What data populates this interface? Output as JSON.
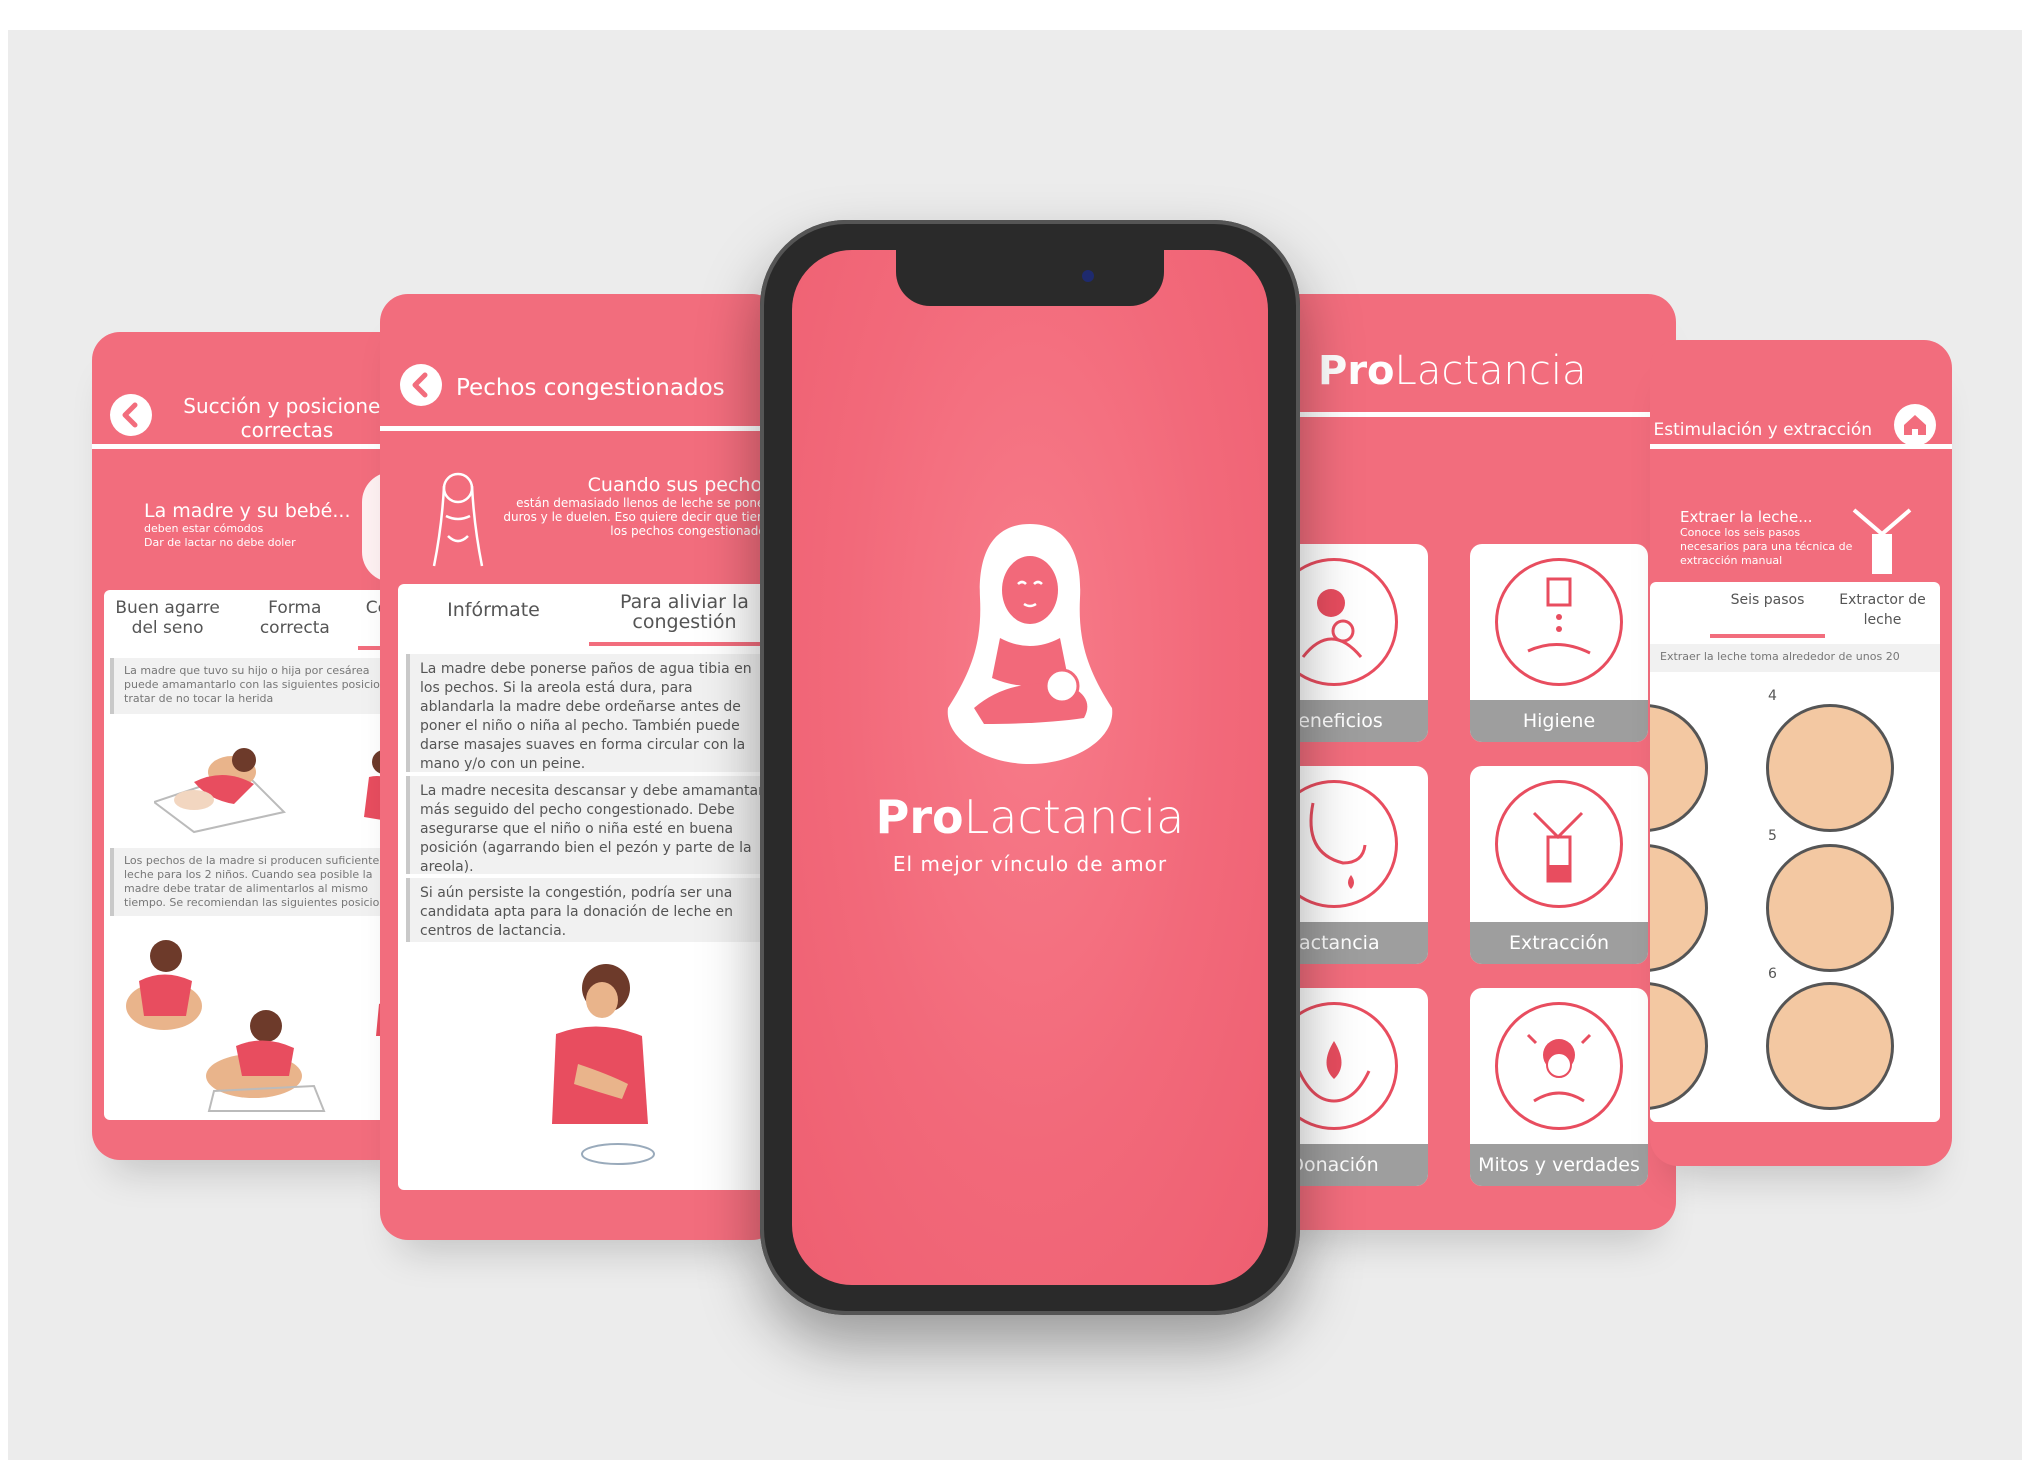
{
  "screens": {
    "succion": {
      "title_line1": "Succión y posiciones",
      "title_line2": "correctas",
      "banner_title": "La madre y su bebé...",
      "banner_sub1": "deben estar cómodos",
      "banner_sub2": "Dar de lactar no debe doler",
      "tabs": [
        "Buen agarre del seno",
        "Forma correcta",
        "Ce do"
      ],
      "text1": "La madre que tuvo su hijo o hija por cesárea puede amamantarlo con las siguientes posiciones tratar de no tocar la herida",
      "text2": "Los pechos de la madre si producen suficiente leche para los 2 niños. Cuando sea posible la madre debe tratar de alimentarlos al mismo tiempo. Se recomiendan las siguientes posiciones"
    },
    "pechos": {
      "title": "Pechos congestionados",
      "banner_title": "Cuando sus pechos",
      "banner_text": "están demasiado llenos de leche se ponen duros y le duelen. Eso quiere decir que tiene los pechos congestionados",
      "tabs": [
        "Infórmate",
        "Para aliviar la congestión"
      ],
      "p1": "La madre debe ponerse paños de agua tibia en los pechos. Si la areola está dura, para ablandarla la madre debe ordeñarse antes de poner el niño o niña al pecho. También puede darse masajes suaves en forma circular con la mano y/o con un peine.",
      "p2": "La madre necesita descansar y debe amamantar más seguido del pecho congestionado. Debe asegurarse que el niño o niña esté en buena posición (agarrando bien el pezón y parte de la areola).",
      "p3": "Si aún persiste la congestión, podría ser una candidata apta para la donación de leche en centros de lactancia."
    },
    "splash": {
      "brand_bold": "Pro",
      "brand_light": "Lactancia",
      "tagline": "El mejor vínculo de amor"
    },
    "menu": {
      "brand_bold": "Pro",
      "brand_light": "Lactancia",
      "items": [
        "Beneficios",
        "Higiene",
        "Lactancia",
        "Extracción",
        "Donación",
        "Mitos y verdades"
      ]
    },
    "estimulacion": {
      "title": "Estimulación y extracción",
      "banner_title": "Extraer la leche...",
      "banner_text": "Conoce los seis pasos necesarios para una técnica de extracción manual",
      "tabs": [
        "Seis pasos",
        "Extractor de leche"
      ],
      "intro": "Extraer la leche toma alrededor de unos 20",
      "steps": [
        "4",
        "5",
        "6"
      ]
    }
  },
  "colors": {
    "brand": "#f26d7d",
    "accent": "#e84d5f",
    "label_bg": "#9e9e9e"
  }
}
